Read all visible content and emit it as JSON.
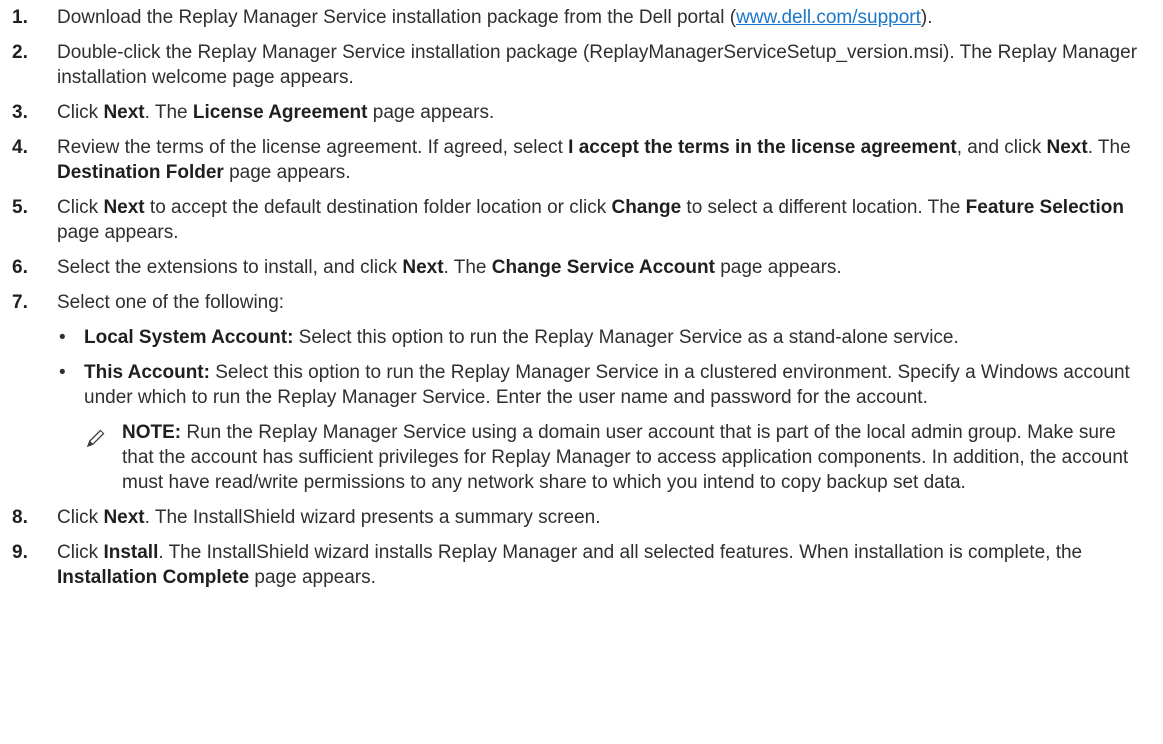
{
  "steps": [
    {
      "num": "1.",
      "pre": "Download the Replay Manager Service installation package from the Dell portal (",
      "link": "www.dell.com/support",
      "post": ")."
    },
    {
      "num": "2.",
      "text": "Double-click the Replay Manager Service installation package (ReplayManagerServiceSetup_version.msi). The Replay Manager installation welcome page appears."
    },
    {
      "num": "3.",
      "a": "Click ",
      "b1": "Next",
      "c": ". The ",
      "b2": "License Agreement",
      "d": " page appears."
    },
    {
      "num": "4.",
      "a": "Review the terms of the license agreement. If agreed, select ",
      "b1": "I accept the terms in the license agreement",
      "c": ", and click ",
      "b2": "Next",
      "d": ". The ",
      "b3": "Destination Folder",
      "e": " page appears."
    },
    {
      "num": "5.",
      "a": "Click ",
      "b1": "Next",
      "c": " to accept the default destination folder location or click ",
      "b2": "Change",
      "d": " to select a different location. The ",
      "b3": "Feature Selection",
      "e": " page appears."
    },
    {
      "num": "6.",
      "a": "Select the extensions to install, and click ",
      "b1": "Next",
      "c": ". The ",
      "b2": "Change Service Account",
      "d": " page appears."
    },
    {
      "num": "7.",
      "text": "Select one of the following:",
      "options": [
        {
          "bullet": "•",
          "label": "Local System Account:",
          "text": " Select this option to run the Replay Manager Service as a stand-alone service."
        },
        {
          "bullet": "•",
          "label": "This Account:",
          "text": " Select this option to run the Replay Manager Service in a clustered environment. Specify a Windows account under which to run the Replay Manager Service. Enter the user name and password for the account."
        }
      ],
      "note": {
        "icon": "pencil-note-icon",
        "label": "NOTE:",
        "text": " Run the Replay Manager Service using a domain user account that is part of the local admin group. Make sure that the account has sufficient privileges for Replay Manager to access application components. In addition, the account must have read/write permissions to any network share to which you intend to copy backup set data."
      }
    },
    {
      "num": "8.",
      "a": "Click ",
      "b1": "Next",
      "c": ". The InstallShield wizard presents a summary screen."
    },
    {
      "num": "9.",
      "a": "Click ",
      "b1": "Install",
      "c": ". The InstallShield wizard installs Replay Manager and all selected features. When installation is complete, the ",
      "b2": "Installation Complete",
      "d": " page appears."
    }
  ],
  "colors": {
    "text": "#2f2f2f",
    "link": "#1a77c9"
  }
}
